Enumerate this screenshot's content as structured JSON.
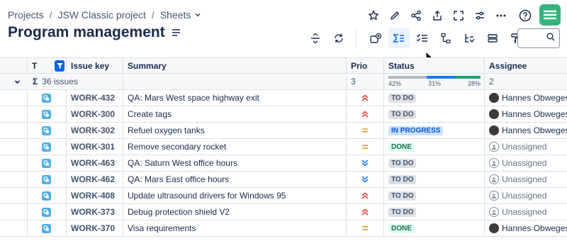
{
  "breadcrumb": {
    "projects": "Projects",
    "project": "JSW Classic project",
    "sheets": "Sheets",
    "separator": "/"
  },
  "page": {
    "title": "Program management"
  },
  "search": {
    "placeholder": ""
  },
  "colors": {
    "accent": "#0c66e4",
    "app_logo": "#36b37e",
    "issue_type": "#4bade8",
    "prio_high": "#e2483d",
    "prio_medium": "#e2a03f",
    "prio_low": "#1d7afc",
    "progress_todo": "#b3b9c4",
    "progress_inprogress": "#1d7afc",
    "progress_done": "#22a06b"
  },
  "columns": {
    "type": "T",
    "key": "Issue key",
    "summary": "Summary",
    "prio": "Prio",
    "status": "Status",
    "assignee": "Assignee"
  },
  "summary_row": {
    "sigma": "Σ",
    "issues": "36 issues",
    "prio_count": "3",
    "assignee_count": "2",
    "progress": {
      "todo": "42%",
      "inprogress": "31%",
      "done": "28%",
      "todo_value": 42,
      "inprogress_value": 31,
      "done_value": 28
    }
  },
  "rows": [
    {
      "key": "WORK-432",
      "summary": "QA: Mars West space highway exit",
      "prio": "high",
      "status": "TO DO",
      "status_type": "todo",
      "assignee": "Hannes Obwegeser",
      "assigned": true
    },
    {
      "key": "WORK-300",
      "summary": "Create tags",
      "prio": "high",
      "status": "TO DO",
      "status_type": "todo",
      "assignee": "Hannes Obwegeser",
      "assigned": true
    },
    {
      "key": "WORK-302",
      "summary": "Refuel oxygen tanks",
      "prio": "medium",
      "status": "IN PROGRESS",
      "status_type": "inprog",
      "assignee": "Hannes Obwegeser",
      "assigned": true
    },
    {
      "key": "WORK-301",
      "summary": "Remove secondary rocket",
      "prio": "medium",
      "status": "DONE",
      "status_type": "done",
      "assignee": "Unassigned",
      "assigned": false
    },
    {
      "key": "WORK-463",
      "summary": "QA: Saturn West office hours",
      "prio": "low",
      "status": "TO DO",
      "status_type": "todo",
      "assignee": "Unassigned",
      "assigned": false
    },
    {
      "key": "WORK-462",
      "summary": "QA: Mars East office hours",
      "prio": "low",
      "status": "TO DO",
      "status_type": "todo",
      "assignee": "Unassigned",
      "assigned": false
    },
    {
      "key": "WORK-408",
      "summary": "Update ultrasound drivers for Windows 95",
      "prio": "high",
      "status": "TO DO",
      "status_type": "todo",
      "assignee": "Unassigned",
      "assigned": false
    },
    {
      "key": "WORK-373",
      "summary": "Debug protection shield V2",
      "prio": "high",
      "status": "TO DO",
      "status_type": "todo",
      "assignee": "Unassigned",
      "assigned": false
    },
    {
      "key": "WORK-370",
      "summary": "Visa requirements",
      "prio": "medium",
      "status": "DONE",
      "status_type": "done",
      "assignee": "Hannes Obwegeser",
      "assigned": true
    }
  ],
  "top_icons": [
    "star-icon",
    "edit-icon",
    "share-icon",
    "export-icon",
    "fullscreen-icon",
    "settings-sliders-icon",
    "more-icon",
    "help-icon"
  ],
  "toolbar_icons": [
    "row-height-icon",
    "refresh-icon",
    "issue-add-icon",
    "sum-icon",
    "checklist-icon",
    "hierarchy-icon",
    "hierarchy-filter-icon",
    "group-icon",
    "format-painter-icon"
  ]
}
